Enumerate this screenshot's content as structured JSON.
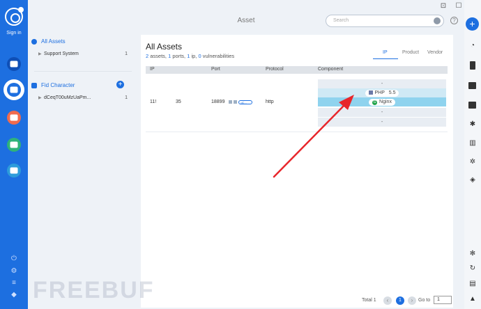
{
  "rail": {
    "signin": "Sign in",
    "items": [
      {
        "name": "hat-icon",
        "color": "#1557c0"
      },
      {
        "name": "list-icon",
        "color": "#1d6fe0"
      },
      {
        "name": "bot-icon",
        "color": "#f06b4e"
      },
      {
        "name": "chart-icon",
        "color": "#2fb37a"
      },
      {
        "name": "puzzle-icon",
        "color": "#2d9cdb"
      }
    ]
  },
  "header": {
    "title": "Asset",
    "search_placeholder": "Search"
  },
  "left_panel": {
    "all_assets": "All Assets",
    "items": [
      {
        "label": "Support System",
        "count": "1"
      }
    ],
    "fid_title": "Fid Character",
    "fid_items": [
      {
        "label": "dCeqT00uMzUaPm...",
        "count": "1"
      }
    ]
  },
  "main": {
    "title": "All Assets",
    "summary": {
      "assets_n": "2",
      "assets_t": " assets, ",
      "ports_n": "1",
      "ports_t": " ports, ",
      "ip_n": "1",
      "ip_t": " ip, ",
      "vuln_n": "0",
      "vuln_t": " vulnerabilities"
    },
    "view_tabs": [
      "IP",
      "Product",
      "Vendor"
    ],
    "columns": [
      "IP",
      "Port",
      "Protocol",
      "Component"
    ],
    "row": {
      "ip": "11!",
      "ip2": "35",
      "port": "18899",
      "port_tag": "dC...",
      "protocol": "http",
      "components": [
        "-",
        "PHP",
        "Nginx",
        "-",
        "-"
      ],
      "php_version": "5.5"
    }
  },
  "footer": {
    "total": "Total 1",
    "page": "1",
    "goto": "Go to",
    "goto_value": "1"
  },
  "watermark": "FREEBUF"
}
